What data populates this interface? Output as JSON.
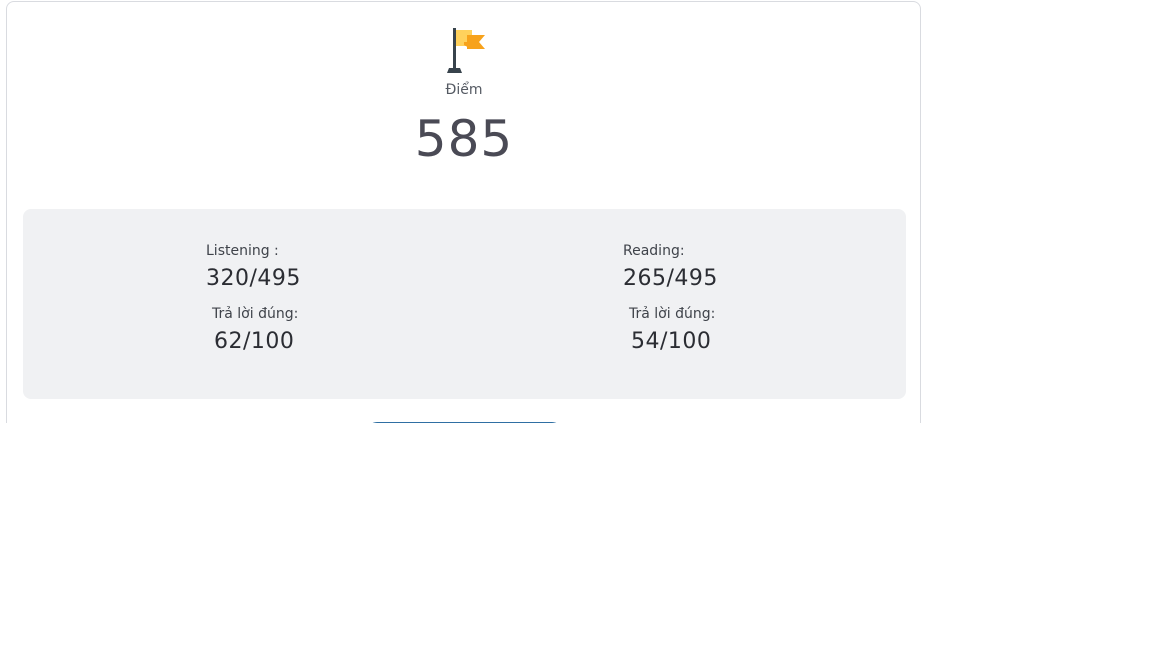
{
  "score": {
    "icon": "flag-icon",
    "label": "Điểm",
    "value": "585"
  },
  "listening": {
    "label": "Listening :",
    "score": "320/495",
    "correct_label": "Trả lời đúng:",
    "correct_value": "62/100"
  },
  "reading": {
    "label": "Reading:",
    "score": "265/495",
    "correct_label": "Trả lời đúng:",
    "correct_value": "54/100"
  },
  "colors": {
    "flag_primary": "#f7a21b",
    "flag_light": "#ffd15c",
    "pole": "#38434c",
    "panel": "#f0f1f3",
    "button_border": "#2f6fa3"
  }
}
